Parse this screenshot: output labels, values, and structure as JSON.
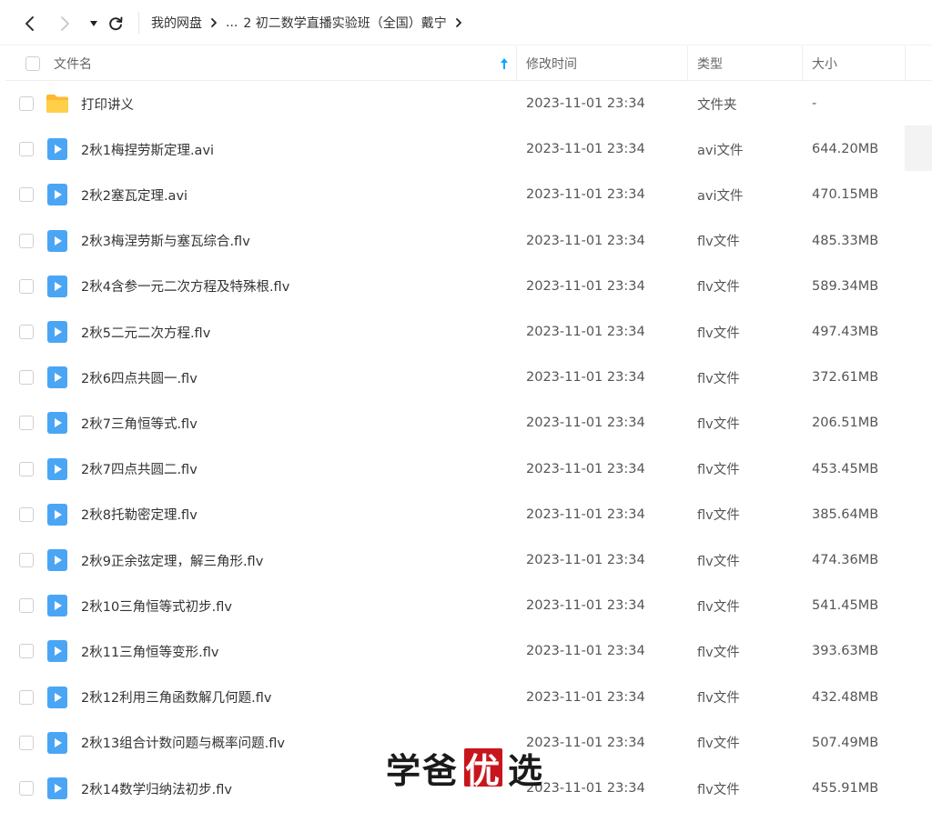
{
  "nav": {
    "breadcrumb": [
      "我的网盘",
      "...",
      "2 初二数学直播实验班（全国）戴宁"
    ]
  },
  "columns": {
    "name": "文件名",
    "modified": "修改时间",
    "type": "类型",
    "size": "大小"
  },
  "colors": {
    "accent": "#06a7ff",
    "folder": "#ffc53d",
    "video": "#4aa6f5"
  },
  "files": [
    {
      "name": "打印讲义",
      "icon": "folder-icon",
      "time": "2023-11-01 23:34",
      "type": "文件夹",
      "size": "-"
    },
    {
      "name": "2秋1梅捏劳斯定理.avi",
      "icon": "video-file-icon",
      "time": "2023-11-01 23:34",
      "type": "avi文件",
      "size": "644.20MB"
    },
    {
      "name": "2秋2塞瓦定理.avi",
      "icon": "video-file-icon",
      "time": "2023-11-01 23:34",
      "type": "avi文件",
      "size": "470.15MB"
    },
    {
      "name": "2秋3梅涅劳斯与塞瓦综合.flv",
      "icon": "video-file-icon",
      "time": "2023-11-01 23:34",
      "type": "flv文件",
      "size": "485.33MB"
    },
    {
      "name": "2秋4含参一元二次方程及特殊根.flv",
      "icon": "video-file-icon",
      "time": "2023-11-01 23:34",
      "type": "flv文件",
      "size": "589.34MB"
    },
    {
      "name": "2秋5二元二次方程.flv",
      "icon": "video-file-icon",
      "time": "2023-11-01 23:34",
      "type": "flv文件",
      "size": "497.43MB"
    },
    {
      "name": "2秋6四点共圆一.flv",
      "icon": "video-file-icon",
      "time": "2023-11-01 23:34",
      "type": "flv文件",
      "size": "372.61MB"
    },
    {
      "name": "2秋7三角恒等式.flv",
      "icon": "video-file-icon",
      "time": "2023-11-01 23:34",
      "type": "flv文件",
      "size": "206.51MB"
    },
    {
      "name": "2秋7四点共圆二.flv",
      "icon": "video-file-icon",
      "time": "2023-11-01 23:34",
      "type": "flv文件",
      "size": "453.45MB"
    },
    {
      "name": "2秋8托勒密定理.flv",
      "icon": "video-file-icon",
      "time": "2023-11-01 23:34",
      "type": "flv文件",
      "size": "385.64MB"
    },
    {
      "name": "2秋9正余弦定理，解三角形.flv",
      "icon": "video-file-icon",
      "time": "2023-11-01 23:34",
      "type": "flv文件",
      "size": "474.36MB"
    },
    {
      "name": "2秋10三角恒等式初步.flv",
      "icon": "video-file-icon",
      "time": "2023-11-01 23:34",
      "type": "flv文件",
      "size": "541.45MB"
    },
    {
      "name": "2秋11三角恒等变形.flv",
      "icon": "video-file-icon",
      "time": "2023-11-01 23:34",
      "type": "flv文件",
      "size": "393.63MB"
    },
    {
      "name": "2秋12利用三角函数解几何题.flv",
      "icon": "video-file-icon",
      "time": "2023-11-01 23:34",
      "type": "flv文件",
      "size": "432.48MB"
    },
    {
      "name": "2秋13组合计数问题与概率问题.flv",
      "icon": "video-file-icon",
      "time": "2023-11-01 23:34",
      "type": "flv文件",
      "size": "507.49MB"
    },
    {
      "name": "2秋14数学归纳法初步.flv",
      "icon": "video-file-icon",
      "time": "2023-11-01 23:34",
      "type": "flv文件",
      "size": "455.91MB"
    }
  ],
  "watermark": {
    "part1": "学爸",
    "box": "优",
    "part2": "选"
  }
}
